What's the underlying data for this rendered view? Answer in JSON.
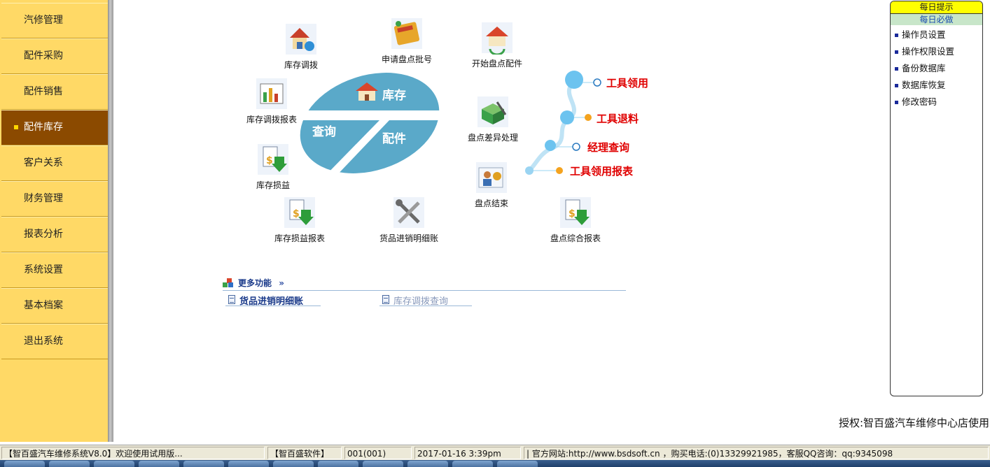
{
  "nav": {
    "items": [
      {
        "label": "汽修管理",
        "active": false
      },
      {
        "label": "配件采购",
        "active": false
      },
      {
        "label": "配件销售",
        "active": false
      },
      {
        "label": "配件库存",
        "active": true
      },
      {
        "label": "客户关系",
        "active": false
      },
      {
        "label": "财务管理",
        "active": false
      },
      {
        "label": "报表分析",
        "active": false
      },
      {
        "label": "系统设置",
        "active": false
      },
      {
        "label": "基本档案",
        "active": false
      },
      {
        "label": "退出系统",
        "active": false
      }
    ]
  },
  "hub": {
    "top_label": "库存",
    "left_label": "查询",
    "right_label": "配件"
  },
  "tiles": {
    "transfer": "库存调拨",
    "apply_count_no": "申请盘点批号",
    "start_count": "开始盘点配件",
    "transfer_report": "库存调拨报表",
    "count_diff": "盘点差异处理",
    "stock_pl": "库存损益",
    "count_end": "盘点结束",
    "stock_pl_report": "库存损益报表",
    "goods_detail": "货品进销明细账",
    "count_summary_report": "盘点综合报表"
  },
  "tools": {
    "borrow": "工具领用",
    "return": "工具退料",
    "manager_query": "经理查询",
    "borrow_report": "工具领用报表"
  },
  "more": {
    "title": "更多功能",
    "links": [
      "货品进销明细账",
      "库存调拨查询"
    ]
  },
  "tips": {
    "title": "每日提示",
    "subtitle": "每日必做",
    "items": [
      "操作员设置",
      "操作权限设置",
      "备份数据库",
      "数据库恢复",
      "修改密码"
    ]
  },
  "license": "授权:智百盛汽车维修中心店使用",
  "status": {
    "welcome": "【智百盛汽车维修系统V8.0】欢迎使用试用版...",
    "company": "【智百盛软件】",
    "user": "001(001)",
    "datetime": "2017-01-16 3:39pm",
    "contact": "| 官方网站:http://www.bsdsoft.cn ，购买电话:(0)13329921985，客服QQ咨询：qq:9345098"
  },
  "colors": {
    "sidebar_bg": "#ffd966",
    "nav_active": "#8b4a00",
    "hub_blue": "#5aa9c9",
    "tool_red": "#e00000"
  }
}
